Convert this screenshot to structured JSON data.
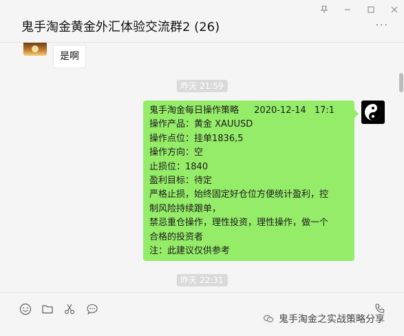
{
  "window": {
    "title": "鬼手淘金黄金外汇体验交流群2 (26)",
    "controls": {
      "pin_icon": "pin-icon",
      "minimize_icon": "minimize-icon",
      "maximize_icon": "maximize-icon",
      "close_icon": "close-icon"
    },
    "more_label": "···"
  },
  "chat": {
    "messages": [
      {
        "side": "left",
        "text": "是啊"
      },
      {
        "side": "right",
        "time": "昨天 21:59",
        "lines": [
          {
            "name": "鬼手淘金每日操作策略",
            "date": "2020-12-14",
            "time": "17:1"
          },
          "  操作产品：黄金  XAUUSD",
          "  操作点位：挂单1836,5",
          "  操作方向：空",
          "  止损位：1840",
          "  盈利目标：待定",
          "  严格止损，始终固定好仓位方便统计盈利，控",
          "制风险持续跟单，",
          "  禁忌重仓操作，理性投资，理性操作，做一个",
          "合格的投资者",
          "  注：此建议仅供参考"
        ]
      },
      {
        "time": "昨天 22:31"
      }
    ]
  },
  "toolbar": {
    "emoji_icon": "emoji-icon",
    "file_icon": "folder-icon",
    "cut_icon": "scissors-icon",
    "chat_icon": "chat-bubble-icon",
    "call_icon": "call-icon"
  },
  "watermark": {
    "text": "鬼手淘金之实战策略分享"
  }
}
